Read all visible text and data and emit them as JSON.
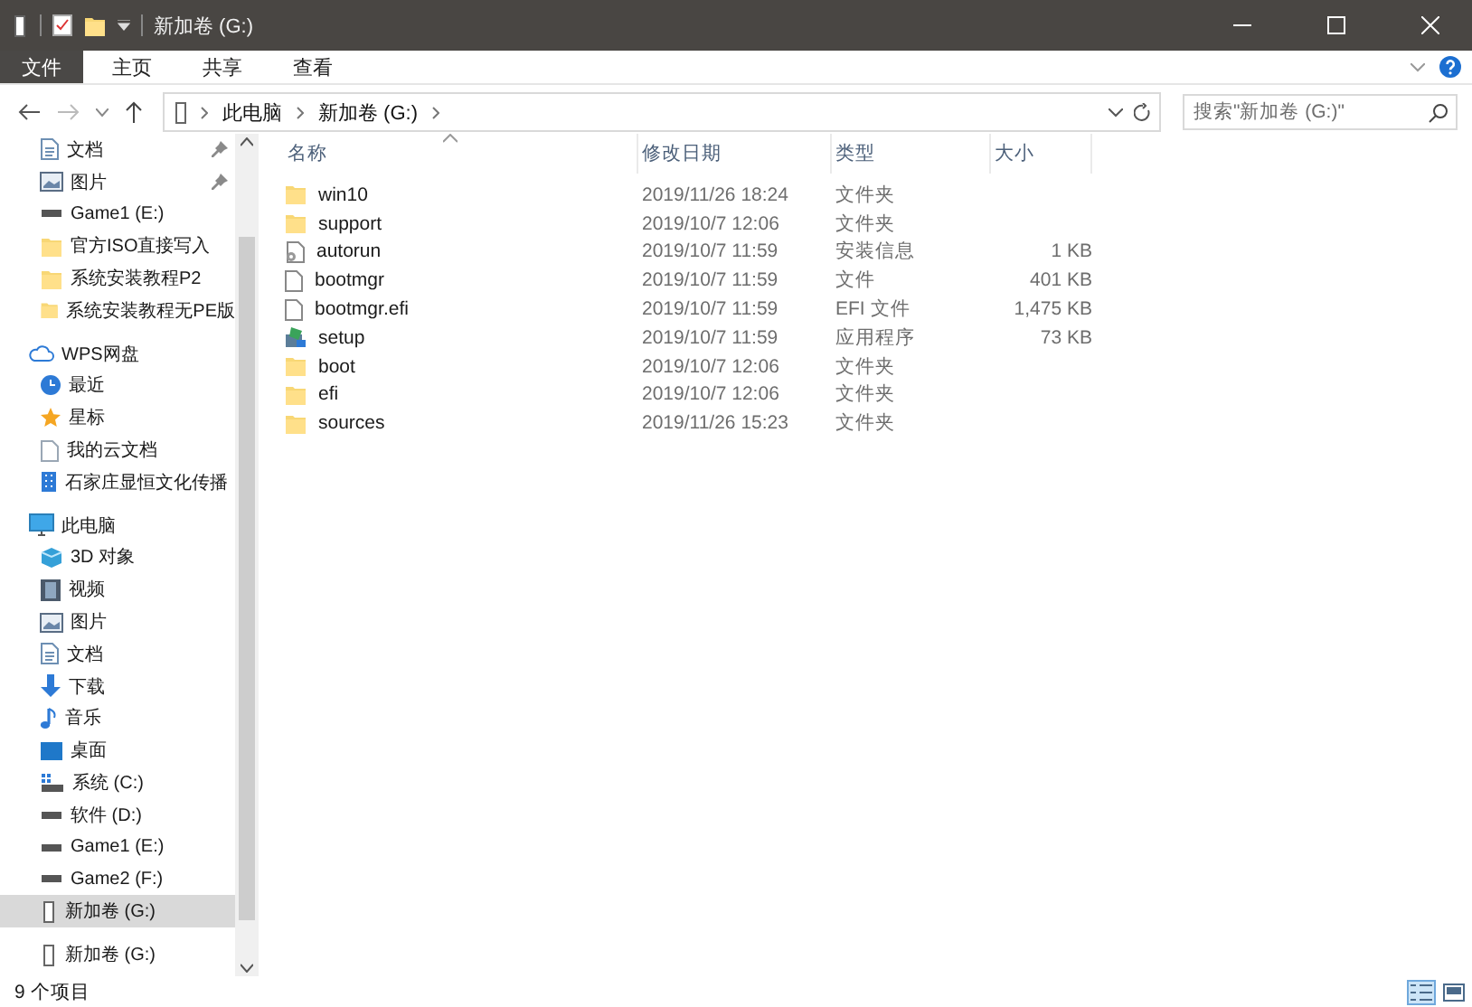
{
  "window": {
    "title": "新加卷 (G:)"
  },
  "ribbon_tabs": [
    {
      "label": "文件",
      "selected": true
    },
    {
      "label": "主页",
      "selected": false
    },
    {
      "label": "共享",
      "selected": false
    },
    {
      "label": "查看",
      "selected": false
    }
  ],
  "address": {
    "crumbs": [
      "此电脑",
      "新加卷 (G:)"
    ]
  },
  "search": {
    "placeholder": "搜索\"新加卷 (G:)\""
  },
  "sidebar": {
    "items": [
      {
        "label": "文档",
        "kind": "doc",
        "pinned": true,
        "selected": false
      },
      {
        "label": "图片",
        "kind": "picture",
        "pinned": true,
        "selected": false
      },
      {
        "label": "Game1 (E:)",
        "kind": "drive",
        "pinned": false,
        "selected": false
      },
      {
        "label": "官方ISO直接写入",
        "kind": "folder",
        "pinned": false,
        "selected": false
      },
      {
        "label": "系统安装教程P2",
        "kind": "folder",
        "pinned": false,
        "selected": false
      },
      {
        "label": "系统安装教程无PE版",
        "kind": "folder",
        "pinned": false,
        "selected": false
      },
      {
        "label": "WPS网盘",
        "kind": "cloud",
        "pinned": false,
        "selected": false,
        "children": [
          {
            "label": "最近",
            "kind": "clock",
            "selected": false
          },
          {
            "label": "星标",
            "kind": "star",
            "selected": false
          },
          {
            "label": "我的云文档",
            "kind": "clouddoc",
            "selected": false
          },
          {
            "label": "石家庄显恒文化传播",
            "kind": "building",
            "selected": false
          }
        ]
      },
      {
        "label": "此电脑",
        "kind": "pc",
        "pinned": false,
        "selected": false,
        "children": [
          {
            "label": "3D 对象",
            "kind": "cube",
            "selected": false
          },
          {
            "label": "视频",
            "kind": "video",
            "selected": false
          },
          {
            "label": "图片",
            "kind": "picture",
            "selected": false
          },
          {
            "label": "文档",
            "kind": "doc",
            "selected": false
          },
          {
            "label": "下载",
            "kind": "download",
            "selected": false
          },
          {
            "label": "音乐",
            "kind": "music",
            "selected": false
          },
          {
            "label": "桌面",
            "kind": "desktop",
            "selected": false
          },
          {
            "label": "系统 (C:)",
            "kind": "sysdrive",
            "selected": false
          },
          {
            "label": "软件 (D:)",
            "kind": "drive",
            "selected": false
          },
          {
            "label": "Game1 (E:)",
            "kind": "drive",
            "selected": false
          },
          {
            "label": "Game2 (F:)",
            "kind": "drive",
            "selected": false
          },
          {
            "label": "新加卷 (G:)",
            "kind": "usb",
            "selected": true
          }
        ]
      },
      {
        "label": "新加卷 (G:)",
        "kind": "usb",
        "pinned": false,
        "selected": false
      }
    ]
  },
  "table": {
    "columns": [
      "名称",
      "修改日期",
      "类型",
      "大小"
    ],
    "rows": [
      {
        "name": "win10",
        "kind": "folder",
        "modified": "2019/11/26 18:24",
        "type": "文件夹",
        "size": ""
      },
      {
        "name": "support",
        "kind": "folder",
        "modified": "2019/10/7 12:06",
        "type": "文件夹",
        "size": ""
      },
      {
        "name": "autorun",
        "kind": "settings",
        "modified": "2019/10/7 11:59",
        "type": "安装信息",
        "size": "1 KB"
      },
      {
        "name": "bootmgr",
        "kind": "file",
        "modified": "2019/10/7 11:59",
        "type": "文件",
        "size": "401 KB"
      },
      {
        "name": "bootmgr.efi",
        "kind": "file",
        "modified": "2019/10/7 11:59",
        "type": "EFI 文件",
        "size": "1,475 KB"
      },
      {
        "name": "setup",
        "kind": "app",
        "modified": "2019/10/7 11:59",
        "type": "应用程序",
        "size": "73 KB"
      },
      {
        "name": "boot",
        "kind": "folder",
        "modified": "2019/10/7 12:06",
        "type": "文件夹",
        "size": ""
      },
      {
        "name": "efi",
        "kind": "folder",
        "modified": "2019/10/7 12:06",
        "type": "文件夹",
        "size": ""
      },
      {
        "name": "sources",
        "kind": "folder",
        "modified": "2019/11/26 15:23",
        "type": "文件夹",
        "size": ""
      }
    ]
  },
  "status_bar": {
    "count": "9 个项目",
    "views": [
      {
        "kind": "details",
        "selected": true
      },
      {
        "kind": "large",
        "selected": false
      }
    ]
  }
}
